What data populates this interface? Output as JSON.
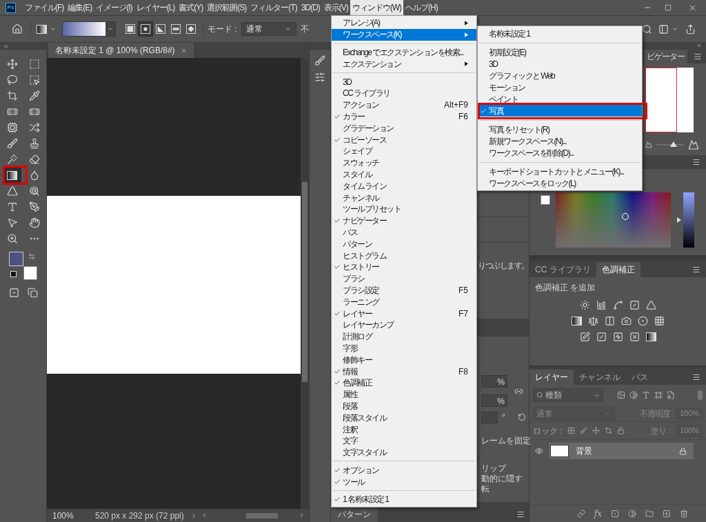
{
  "app": {
    "logo": "Ps"
  },
  "menu_bar": [
    {
      "label": "ファイル(F)",
      "selected": false
    },
    {
      "label": "編集(E)",
      "selected": false
    },
    {
      "label": "イメージ(I)",
      "selected": false
    },
    {
      "label": "レイヤー(L)",
      "selected": false
    },
    {
      "label": "書式(Y)",
      "selected": false
    },
    {
      "label": "選択範囲(S)",
      "selected": false
    },
    {
      "label": "フィルター(T)",
      "selected": false
    },
    {
      "label": "3D(D)",
      "selected": false
    },
    {
      "label": "表示(V)",
      "selected": false
    },
    {
      "label": "ウィンドウ(W)",
      "selected": true
    },
    {
      "label": "ヘルプ(H)",
      "selected": false
    }
  ],
  "options_bar": {
    "gradient_types": [
      {
        "selected": false
      },
      {
        "selected": true
      },
      {
        "selected": false
      },
      {
        "selected": false
      },
      {
        "selected": false
      }
    ],
    "mode_label": "モード :",
    "mode_value": "通常",
    "opacity_label": "不"
  },
  "tools": [
    {
      "kind": "move",
      "selected": false
    },
    {
      "kind": "marquee",
      "selected": false
    },
    {
      "kind": "lasso",
      "selected": false
    },
    {
      "kind": "object_select",
      "selected": false
    },
    {
      "kind": "crop",
      "selected": false
    },
    {
      "kind": "eyedropper",
      "selected": false
    },
    {
      "kind": "spot_heal",
      "selected": false
    },
    {
      "kind": "heal",
      "selected": false
    },
    {
      "kind": "content_aware",
      "selected": false
    },
    {
      "kind": "shuffle",
      "selected": false
    },
    {
      "kind": "brush",
      "selected": false
    },
    {
      "kind": "stamp",
      "selected": false
    },
    {
      "kind": "history",
      "selected": false
    },
    {
      "kind": "eraser",
      "selected": false
    },
    {
      "kind": "gradient",
      "selected": true
    },
    {
      "kind": "blur",
      "selected": false
    },
    {
      "kind": "sharpen",
      "selected": false
    },
    {
      "kind": "dodge",
      "selected": false
    },
    {
      "kind": "type",
      "selected": false
    },
    {
      "kind": "pen",
      "selected": false
    },
    {
      "kind": "path_select",
      "selected": false
    },
    {
      "kind": "hand",
      "selected": false
    },
    {
      "kind": "zoom",
      "selected": false
    },
    {
      "kind": "more",
      "selected": false
    }
  ],
  "colors": [
    {
      "kind": "foreground",
      "color": "#4b5384"
    },
    {
      "kind": "background",
      "color": "#ffffff"
    }
  ],
  "document": {
    "tab": "名称未設定 1 @ 100% (RGB/8#)",
    "zoom": "100%",
    "dimensions": "520 px x 292 px (72 ppi)"
  },
  "window_menu": {
    "items": [
      {
        "kind": "item",
        "label": "アレンジ(A)",
        "checked": false,
        "submenu": true,
        "selected": false
      },
      {
        "kind": "item",
        "label": "ワークスペース(K)",
        "checked": false,
        "submenu": true,
        "selected": true
      },
      {
        "kind": "separator"
      },
      {
        "kind": "item",
        "label": "Exchange でエクステンションを検索...",
        "checked": false,
        "submenu": false,
        "selected": false
      },
      {
        "kind": "item",
        "label": "エクステンション",
        "checked": false,
        "submenu": true,
        "selected": false
      },
      {
        "kind": "separator"
      },
      {
        "kind": "item",
        "label": "3D",
        "checked": false,
        "submenu": false,
        "selected": false
      },
      {
        "kind": "item",
        "label": "CC ライブラリ",
        "checked": false,
        "submenu": false,
        "selected": false
      },
      {
        "kind": "item",
        "label": "アクション",
        "shortcut": "Alt+F9",
        "checked": false,
        "submenu": false,
        "selected": false
      },
      {
        "kind": "item",
        "label": "カラー",
        "shortcut": "F6",
        "checked": true,
        "submenu": false,
        "selected": false
      },
      {
        "kind": "item",
        "label": "グラデーション",
        "checked": false,
        "submenu": false,
        "selected": false
      },
      {
        "kind": "item",
        "label": "コピーソース",
        "checked": true,
        "submenu": false,
        "selected": false
      },
      {
        "kind": "item",
        "label": "シェイプ",
        "checked": false,
        "submenu": false,
        "selected": false
      },
      {
        "kind": "item",
        "label": "スウォッチ",
        "checked": false,
        "submenu": false,
        "selected": false
      },
      {
        "kind": "item",
        "label": "スタイル",
        "checked": false,
        "submenu": false,
        "selected": false
      },
      {
        "kind": "item",
        "label": "タイムライン",
        "checked": false,
        "submenu": false,
        "selected": false
      },
      {
        "kind": "item",
        "label": "チャンネル",
        "checked": false,
        "submenu": false,
        "selected": false
      },
      {
        "kind": "item",
        "label": "ツールプリセット",
        "checked": false,
        "submenu": false,
        "selected": false
      },
      {
        "kind": "item",
        "label": "ナビゲーター",
        "checked": true,
        "submenu": false,
        "selected": false
      },
      {
        "kind": "item",
        "label": "パス",
        "checked": false,
        "submenu": false,
        "selected": false
      },
      {
        "kind": "item",
        "label": "パターン",
        "checked": false,
        "submenu": false,
        "selected": false
      },
      {
        "kind": "item",
        "label": "ヒストグラム",
        "checked": false,
        "submenu": false,
        "selected": false
      },
      {
        "kind": "item",
        "label": "ヒストリー",
        "checked": true,
        "submenu": false,
        "selected": false
      },
      {
        "kind": "item",
        "label": "ブラシ",
        "checked": false,
        "submenu": false,
        "selected": false
      },
      {
        "kind": "item",
        "label": "ブラシ設定",
        "shortcut": "F5",
        "checked": false,
        "submenu": false,
        "selected": false
      },
      {
        "kind": "item",
        "label": "ラーニング",
        "checked": false,
        "submenu": false,
        "selected": false
      },
      {
        "kind": "item",
        "label": "レイヤー",
        "shortcut": "F7",
        "checked": true,
        "submenu": false,
        "selected": false
      },
      {
        "kind": "item",
        "label": "レイヤーカンプ",
        "checked": false,
        "submenu": false,
        "selected": false
      },
      {
        "kind": "item",
        "label": "計測ログ",
        "checked": false,
        "submenu": false,
        "selected": false
      },
      {
        "kind": "item",
        "label": "字形",
        "checked": false,
        "submenu": false,
        "selected": false
      },
      {
        "kind": "item",
        "label": "修飾キー",
        "checked": false,
        "submenu": false,
        "selected": false
      },
      {
        "kind": "item",
        "label": "情報",
        "shortcut": "F8",
        "checked": true,
        "submenu": false,
        "selected": false
      },
      {
        "kind": "item",
        "label": "色調補正",
        "checked": true,
        "submenu": false,
        "selected": false
      },
      {
        "kind": "item",
        "label": "属性",
        "checked": false,
        "submenu": false,
        "selected": false
      },
      {
        "kind": "item",
        "label": "段落",
        "checked": false,
        "submenu": false,
        "selected": false
      },
      {
        "kind": "item",
        "label": "段落スタイル",
        "checked": false,
        "submenu": false,
        "selected": false
      },
      {
        "kind": "item",
        "label": "注釈",
        "checked": false,
        "submenu": false,
        "selected": false
      },
      {
        "kind": "item",
        "label": "文字",
        "checked": false,
        "submenu": false,
        "selected": false
      },
      {
        "kind": "item",
        "label": "文字スタイル",
        "checked": false,
        "submenu": false,
        "selected": false
      },
      {
        "kind": "separator"
      },
      {
        "kind": "item",
        "label": "オプション",
        "checked": true,
        "submenu": false,
        "selected": false
      },
      {
        "kind": "item",
        "label": "ツール",
        "checked": true,
        "submenu": false,
        "selected": false
      },
      {
        "kind": "separator"
      },
      {
        "kind": "item",
        "label": "1 名称未設定 1",
        "checked": true,
        "submenu": false,
        "selected": false
      }
    ]
  },
  "workspace_submenu": {
    "items": [
      {
        "kind": "item",
        "label": "名称未設定 1",
        "checked": false,
        "selected": false
      },
      {
        "kind": "separator"
      },
      {
        "kind": "item",
        "label": "初期設定(E)",
        "checked": false,
        "selected": false
      },
      {
        "kind": "item",
        "label": "3D",
        "checked": false,
        "selected": false
      },
      {
        "kind": "item",
        "label": "グラフィックと Web",
        "checked": false,
        "selected": false
      },
      {
        "kind": "item",
        "label": "モーション",
        "checked": false,
        "selected": false
      },
      {
        "kind": "item",
        "label": "ペイント",
        "checked": false,
        "selected": false
      },
      {
        "kind": "item",
        "label": "写真",
        "checked": true,
        "selected": true
      },
      {
        "kind": "separator"
      },
      {
        "kind": "item",
        "label": "写真 をリセット(R)",
        "checked": false,
        "selected": false
      },
      {
        "kind": "item",
        "label": "新規ワークスペース(N)...",
        "checked": false,
        "selected": false
      },
      {
        "kind": "item",
        "label": "ワークスペースを削除(D)...",
        "checked": false,
        "selected": false
      },
      {
        "kind": "separator"
      },
      {
        "kind": "item",
        "label": "キーボードショートカットとメニュー(K)...",
        "checked": false,
        "selected": false
      },
      {
        "kind": "item",
        "label": "ワークスペースをロック(L)",
        "checked": false,
        "selected": false
      }
    ]
  },
  "middle_panel": {
    "text": "りつぶします。",
    "fields": [
      {
        "value": "%"
      },
      {
        "value": "%"
      }
    ],
    "angle_unit": "°",
    "lines": [
      "レームを固定",
      "リップ",
      "動的に隠す",
      "転"
    ],
    "bottom_tab": "パターン"
  },
  "navigator": {
    "tab": "ビゲーター",
    "level": 0.62
  },
  "color_panel": {
    "level": 0.5
  },
  "adjustments": {
    "tabs": [
      {
        "label": "CC ライブラリ",
        "selected": false
      },
      {
        "label": "色調補正",
        "selected": true
      }
    ],
    "heading": "色調補正 を追加"
  },
  "layers": {
    "tabs": [
      {
        "label": "レイヤー",
        "selected": true
      },
      {
        "label": "チャンネル",
        "selected": false
      },
      {
        "label": "パス",
        "selected": false
      }
    ],
    "filter": {
      "value": "種類"
    },
    "blend": {
      "value": "通常",
      "disabled": true
    },
    "opacity": {
      "label": "不透明度 :",
      "value": "100%",
      "disabled": true
    },
    "lock_label": "ロック :",
    "fill": {
      "label": "塗り :",
      "value": "100%",
      "disabled": true
    },
    "rows": [
      {
        "name": "背景",
        "visible": true,
        "locked": true,
        "selected": true
      }
    ],
    "fx": "fx"
  }
}
